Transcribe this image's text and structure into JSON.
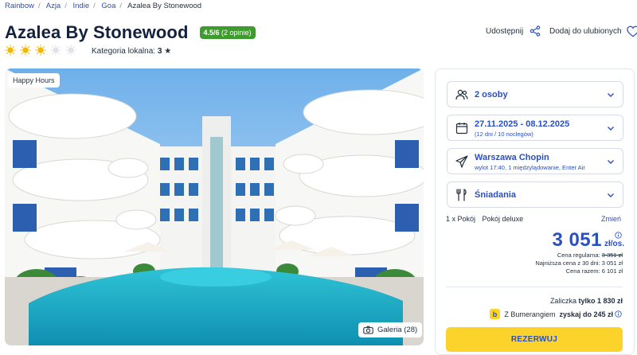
{
  "breadcrumb": [
    "Rainbow",
    "Azja",
    "Indie",
    "Goa",
    "Azalea By Stonewood"
  ],
  "hotel": {
    "name": "Azalea By Stonewood",
    "rating_score": "4.5/6",
    "rating_count": "(2 opinie)",
    "stars_filled": 3,
    "stars_total": 5,
    "category_label": "Kategoria lokalna:",
    "category_value": "3"
  },
  "actions": {
    "share_label": "Udostępnij",
    "favorite_label": "Dodaj do ulubionych"
  },
  "photo": {
    "badge": "Happy Hours",
    "gallery_label": "Galeria (28)"
  },
  "booking": {
    "persons": "2 osoby",
    "dates": "27.11.2025 - 08.12.2025",
    "dates_sub": "(12 dni / 10 noclegów)",
    "flight": "Warszawa Chopin",
    "flight_sub": "wylot 17:40, 1 międzylądowanie, Enter Air",
    "board": "Śniadania",
    "room_label": "1 x Pokój",
    "room_value": "Pokój deluxe",
    "change_label": "Zmień"
  },
  "pricing": {
    "price": "3 051",
    "price_unit": "zł/os.",
    "regular_label": "Cena regularna:",
    "regular_value": "3 351 zł",
    "lowest_label": "Najniższa cena z 30 dni:",
    "lowest_value": "3 051 zł",
    "total_label": "Cena razem:",
    "total_value": "6 101 zł",
    "deposit_label": "Zaliczka",
    "deposit_value": "tylko 1 830 zł",
    "bumerang_label": "Z Bumerangiem",
    "bumerang_value": "zyskaj do 245 zł",
    "reserve_label": "REZERWUJ"
  },
  "colors": {
    "accent": "#2a4fbf",
    "badge_green": "#3f9b2f",
    "cta_yellow": "#fcd32b",
    "star": "#f5b800"
  }
}
